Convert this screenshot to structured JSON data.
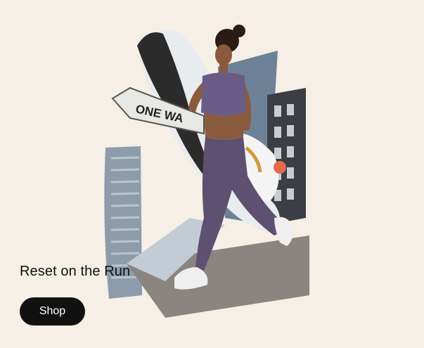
{
  "promo": {
    "headline": "Reset on the Run",
    "cta_label": "Shop",
    "image_icon": "runner-collage-image",
    "sign_text": "ONE WA"
  },
  "colors": {
    "background": "#f5efe6",
    "button_bg": "#111111",
    "button_text": "#ffffff",
    "headline_text": "#111111"
  }
}
